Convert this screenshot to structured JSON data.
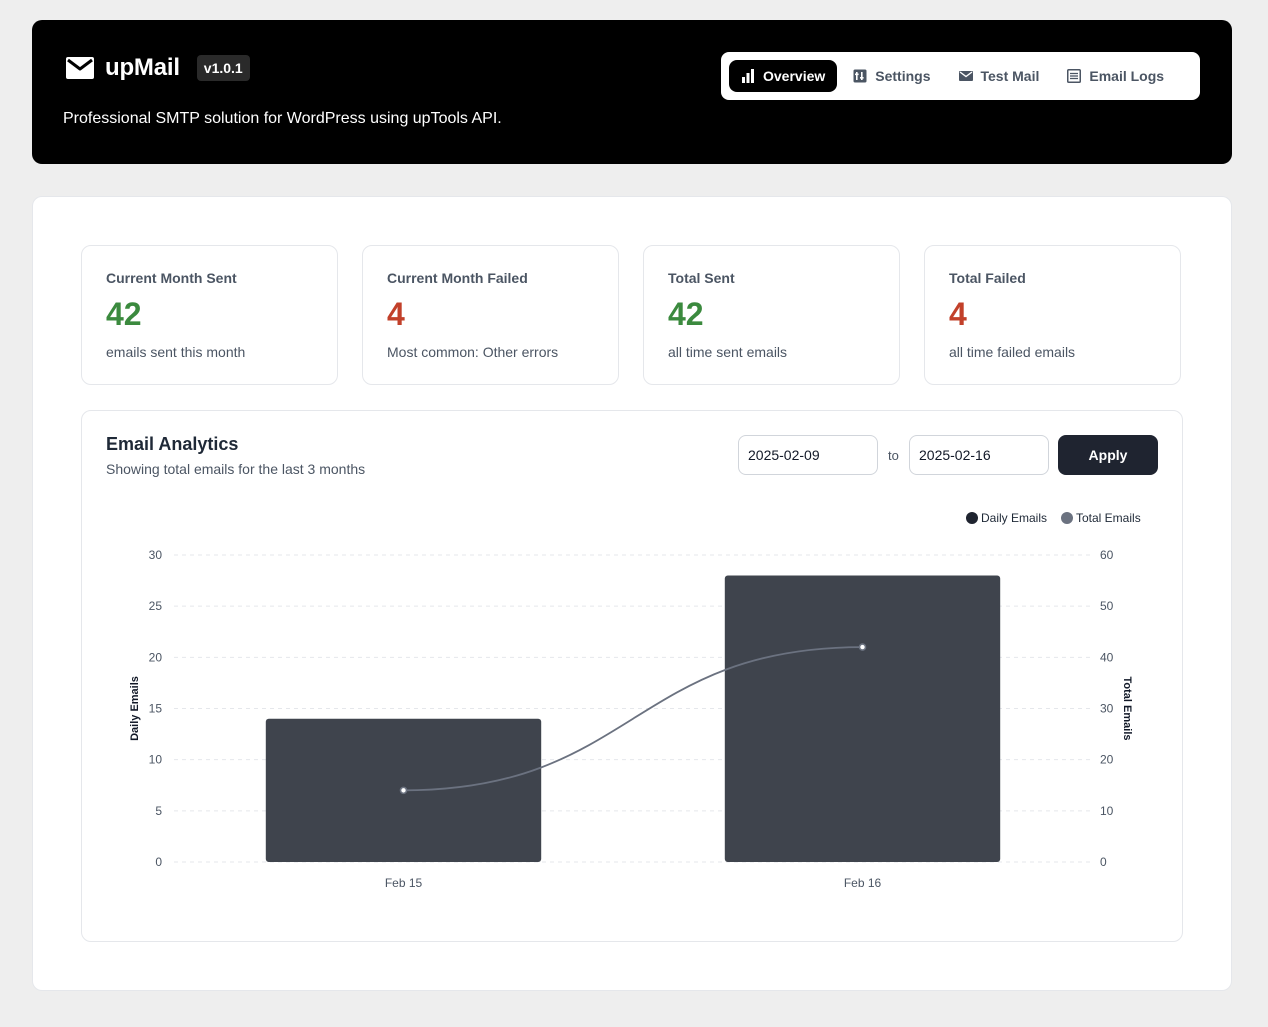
{
  "header": {
    "title": "upMail",
    "version": "v1.0.1",
    "tagline": "Professional SMTP solution for WordPress using upTools API."
  },
  "nav": [
    {
      "label": "Overview",
      "icon": "bar-chart-icon",
      "active": true
    },
    {
      "label": "Settings",
      "icon": "settings-icon",
      "active": false
    },
    {
      "label": "Test Mail",
      "icon": "mail-icon",
      "active": false
    },
    {
      "label": "Email Logs",
      "icon": "list-icon",
      "active": false
    }
  ],
  "stats": [
    {
      "label": "Current Month Sent",
      "value": "42",
      "desc": "emails sent this month",
      "color": "#3b8a3e"
    },
    {
      "label": "Current Month Failed",
      "value": "4",
      "desc": "Most common: Other errors",
      "color": "#c2402a"
    },
    {
      "label": "Total Sent",
      "value": "42",
      "desc": "all time sent emails",
      "color": "#3b8a3e"
    },
    {
      "label": "Total Failed",
      "value": "4",
      "desc": "all time failed emails",
      "color": "#c2402a"
    }
  ],
  "analytics": {
    "title": "Email Analytics",
    "subtitle": "Showing total emails for the last 3 months",
    "date_from": "2025-02-09",
    "date_to": "2025-02-16",
    "to_label": "to",
    "apply_label": "Apply"
  },
  "chart_data": {
    "type": "bar",
    "categories": [
      "Feb 15",
      "Feb 16"
    ],
    "series": [
      {
        "name": "Daily Emails",
        "type": "bar",
        "axis": "left",
        "values": [
          14,
          28
        ],
        "color": "#3f444d"
      },
      {
        "name": "Total Emails",
        "type": "line",
        "axis": "right",
        "values": [
          14,
          42
        ],
        "color": "#6b7280"
      }
    ],
    "ylabel": "Daily Emails",
    "y2label": "Total Emails",
    "ylim": [
      0,
      30
    ],
    "y2lim": [
      0,
      60
    ],
    "yticks": [
      0,
      5,
      10,
      15,
      20,
      25,
      30
    ],
    "y2ticks": [
      0,
      10,
      20,
      30,
      40,
      50,
      60
    ],
    "grid": true,
    "legend": "top-right"
  }
}
